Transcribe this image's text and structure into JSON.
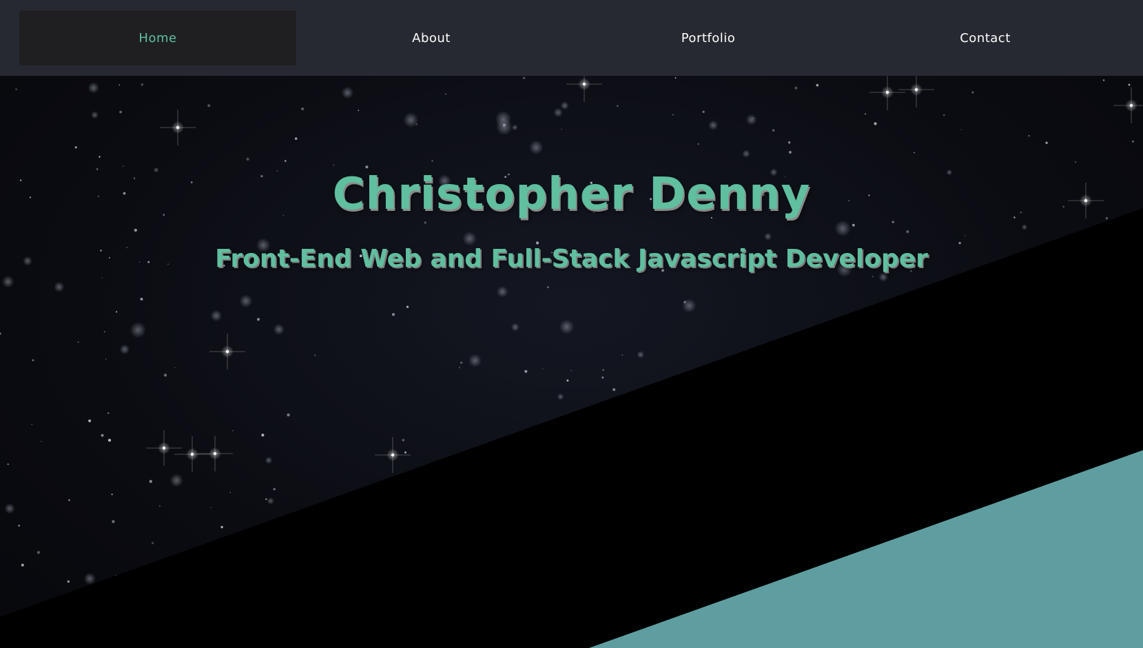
{
  "nav": {
    "items": [
      {
        "label": "Home",
        "active": true
      },
      {
        "label": "About",
        "active": false
      },
      {
        "label": "Portfolio",
        "active": false
      },
      {
        "label": "Contact",
        "active": false
      }
    ]
  },
  "hero": {
    "title": "Christopher Denny",
    "subtitle": "Front-End Web and Full-Stack Javascript Developer"
  },
  "colors": {
    "accent": "#5fbf9f",
    "navbar": "#272932",
    "active_nav": "#1f1f21",
    "teal_shape": "#5f9ea0",
    "black_shape": "#000000"
  }
}
